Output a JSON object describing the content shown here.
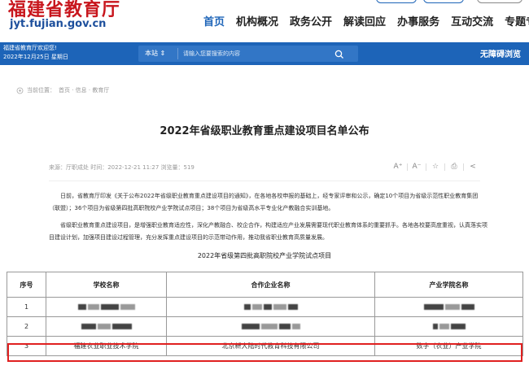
{
  "header": {
    "site_name": "福建省教育厅",
    "site_url": "jyt.fujian.gov.cn",
    "nav": [
      "首页",
      "机构概况",
      "政务公开",
      "解读回应",
      "办事服务",
      "互动交流",
      "专题专栏"
    ]
  },
  "bar": {
    "welcome_line1": "福建省教育厅欢迎您!",
    "welcome_line2": "2022年12月25日 星期日",
    "search_scope": "本站 ⇕",
    "search_placeholder": "请输入您要搜索的内容",
    "accessible": "无障碍浏览"
  },
  "breadcrumb": {
    "prefix": "当前位置：",
    "path": "首页 · 信息 · 教育厅"
  },
  "article": {
    "title": "2022年省级职业教育重点建设项目名单公布",
    "meta": "来源：厅职成处    时间：2022-12-21 11:27    浏览量：519",
    "para1": "日前，省教育厅印发《关于公布2022年省级职业教育重点建设项目的通知》，在各地各校申报的基础上，经专家评审和公示，确定10个项目为省级示范性职业教育集团（联盟）；36个项目为省级第四批高职院校产业学院试点项目；38个项目为省级高水平专业化产教融合实训基地。",
    "para2": "省级职业教育重点建设项目，是增强职业教育适应性，深化产教融合、校企合作，构建适应产业发展需要现代职业教育体系的重要抓手。各地各校要高度重视，认真落实项目建设计划，加强项目建设过程管理，充分发挥重点建设项目的示范带动作用，推动我省职业教育高质量发展。",
    "table_caption": "2022年省级第四批高职院校产业学院试点项目"
  },
  "tools": [
    "A⁺",
    "A⁻",
    "☆",
    "⎙",
    "<"
  ],
  "table": {
    "headers": [
      "序号",
      "学校名称",
      "合作企业名称",
      "产业学院名称"
    ],
    "rows": [
      {
        "no": "1",
        "school": "",
        "company": "",
        "college": ""
      },
      {
        "no": "2",
        "school": "",
        "company": "",
        "college": ""
      },
      {
        "no": "3",
        "school": "福建农业职业技术学院",
        "company": "北京新大陆时代教育科技有限公司",
        "college": "数字（农业）产业学院"
      }
    ]
  },
  "colors": {
    "brand_red": "#c8161d",
    "brand_blue": "#1d64b8",
    "highlight": "#e02020"
  }
}
